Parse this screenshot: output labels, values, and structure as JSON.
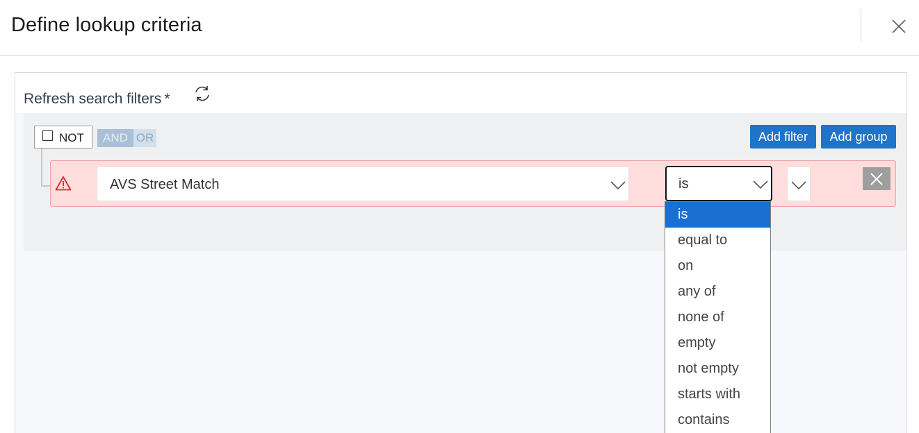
{
  "dialog": {
    "title": "Define lookup criteria"
  },
  "panel": {
    "refresh_label": "Refresh search filters",
    "required_marker": "*"
  },
  "group": {
    "not_label": "NOT",
    "and_label": "AND",
    "or_label": "OR",
    "add_filter_label": "Add filter",
    "add_group_label": "Add group"
  },
  "filter": {
    "field_value": "AVS Street Match",
    "operator_value": "is"
  },
  "operator_dropdown": {
    "selected": "is",
    "options": [
      "is",
      "equal to",
      "on",
      "any of",
      "none of",
      "empty",
      "not empty",
      "starts with",
      "contains"
    ]
  },
  "icons": {
    "close": "close-icon",
    "refresh": "refresh-icon",
    "warning": "warning-icon",
    "chevron": "chevron-down-icon",
    "remove": "remove-icon",
    "checkbox": "checkbox-icon"
  },
  "colors": {
    "primary": "#1f73c9",
    "error_bg": "#ffdddd",
    "error_border": "#f2a0a0",
    "warning": "#e0202a",
    "selected_option": "#1a6fd3"
  }
}
